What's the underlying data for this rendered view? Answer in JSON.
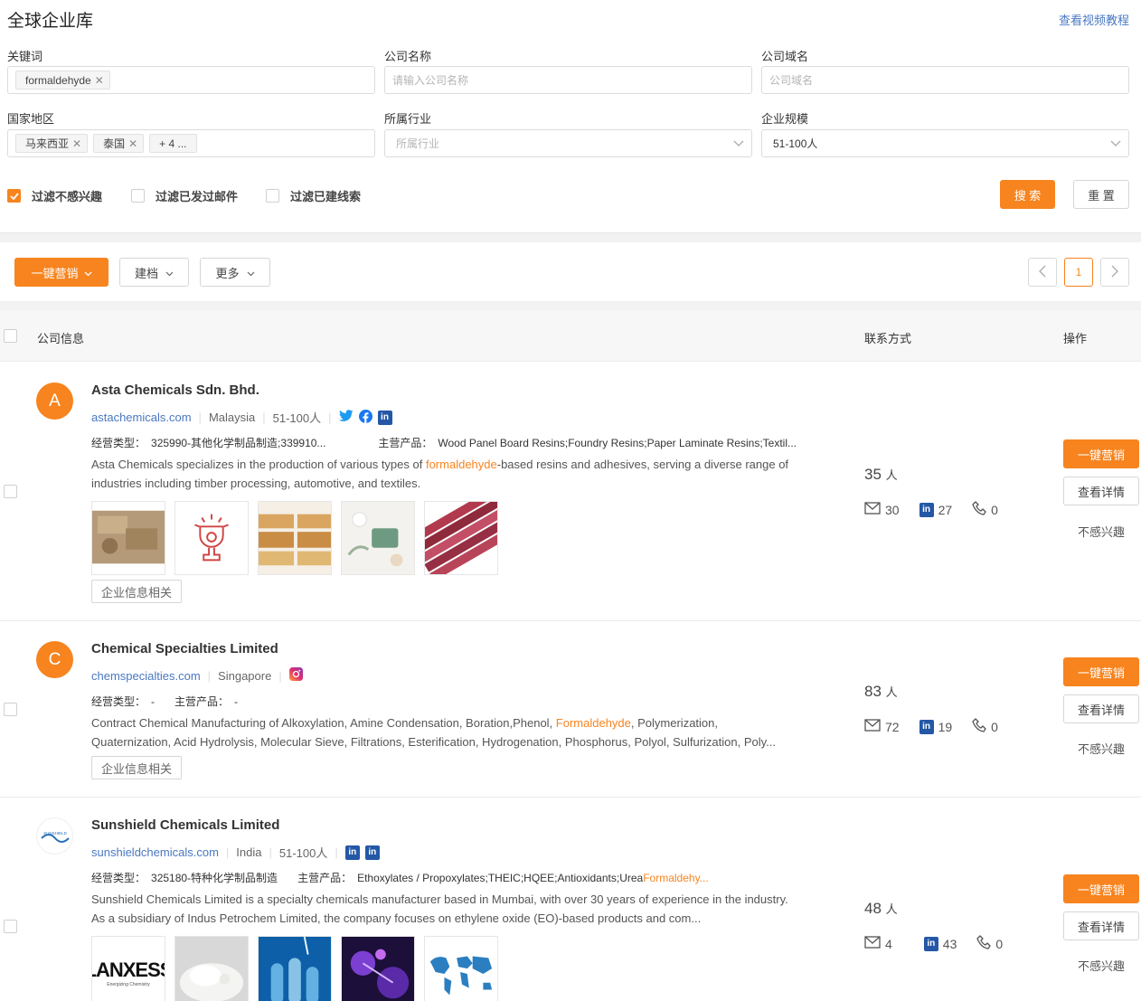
{
  "header": {
    "title": "全球企业库",
    "tutorial": "查看视频教程"
  },
  "filters": {
    "keyword": {
      "label": "关键词",
      "tags": [
        "formaldehyde"
      ]
    },
    "company_name": {
      "label": "公司名称",
      "placeholder": "请输入公司名称"
    },
    "company_domain": {
      "label": "公司域名",
      "placeholder": "公司域名"
    },
    "country": {
      "label": "国家地区",
      "tags": [
        "马来西亚",
        "泰国"
      ],
      "more": "+ 4 ..."
    },
    "industry": {
      "label": "所属行业",
      "placeholder": "所属行业"
    },
    "size": {
      "label": "企业规模",
      "value": "51-100人"
    },
    "checks": [
      {
        "label": "过滤不感兴趣",
        "checked": true
      },
      {
        "label": "过滤已发过邮件",
        "checked": false
      },
      {
        "label": "过滤已建线索",
        "checked": false
      }
    ],
    "search": "搜 索",
    "reset": "重 置"
  },
  "toolbar": {
    "marketing": "一键营销",
    "archive": "建档",
    "more": "更多",
    "page": "1"
  },
  "table": {
    "col_company": "公司信息",
    "col_contact": "联系方式",
    "col_ops": "操作"
  },
  "ops": {
    "marketing": "一键营销",
    "details": "查看详情",
    "not_interested": "不感兴趣"
  },
  "companies": [
    {
      "avatar": "A",
      "name": "Asta Chemicals Sdn. Bhd.",
      "domain": "astachemicals.com",
      "country": "Malaysia",
      "size": "51-100人",
      "socials": [
        "twitter",
        "facebook",
        "linkedin"
      ],
      "biz_label": "经营类型：",
      "biz": "325990-其他化学制品制造;339910...",
      "prod_label": "主营产品：",
      "products": "Wood Panel Board Resins;Foundry Resins;Paper Laminate Resins;Textil...",
      "desc_pre": "Asta Chemicals specializes in the production of various types of ",
      "desc_hl": "formaldehyde",
      "desc_post": "-based resins and adhesives, serving a diverse range of industries including timber processing, automotive, and textiles.",
      "info_tag": "企业信息相关",
      "people": "35",
      "people_unit": "人",
      "emails": "30",
      "linkedin": "27",
      "phones": "0"
    },
    {
      "avatar": "C",
      "name": "Chemical Specialties Limited",
      "domain": "chemspecialties.com",
      "country": "Singapore",
      "socials": [
        "instagram"
      ],
      "biz_label": "经营类型：",
      "biz": "-",
      "prod_label": "主营产品：",
      "products": "-",
      "desc_pre": "Contract Chemical Manufacturing of Alkoxylation, Amine Condensation, Boration,Phenol, ",
      "desc_hl": "Formaldehyde",
      "desc_post": ", Polymerization, Quaternization, Acid Hydrolysis, Molecular Sieve, Filtrations, Esterification, Hydrogenation, Phosphorus, Polyol, Sulfurization, Poly...",
      "info_tag": "企业信息相关",
      "people": "83",
      "people_unit": "人",
      "emails": "72",
      "linkedin": "19",
      "phones": "0"
    },
    {
      "avatar_logo": "SUNSHIELD",
      "name": "Sunshield Chemicals Limited",
      "domain": "sunshieldchemicals.com",
      "country": "India",
      "size": "51-100人",
      "socials": [
        "linkedin",
        "linkedin"
      ],
      "biz_label": "经营类型：",
      "biz": "325180-特种化学制品制造",
      "prod_label": "主营产品：",
      "products_pre": "Ethoxylates / Propoxylates;THEIC;HQEE;Antioxidants;Urea ",
      "products_hl": "Formaldehy...",
      "desc_pre": "Sunshield Chemicals Limited is a specialty chemicals manufacturer based in Mumbai, with over 30 years of experience in the industry. As a subsidiary of Indus Petrochem Limited, the company focuses on ethylene oxide (EO)-based products and com...",
      "thumb_logo": "LANXESS",
      "thumb_logo_sub": "Energizing Chemistry",
      "people": "48",
      "people_unit": "人",
      "emails": "4",
      "linkedin": "43",
      "phones": "0"
    }
  ],
  "colors": {
    "accent": "#f7841f",
    "link": "#4a78c2",
    "linkedin": "#2458a6"
  }
}
